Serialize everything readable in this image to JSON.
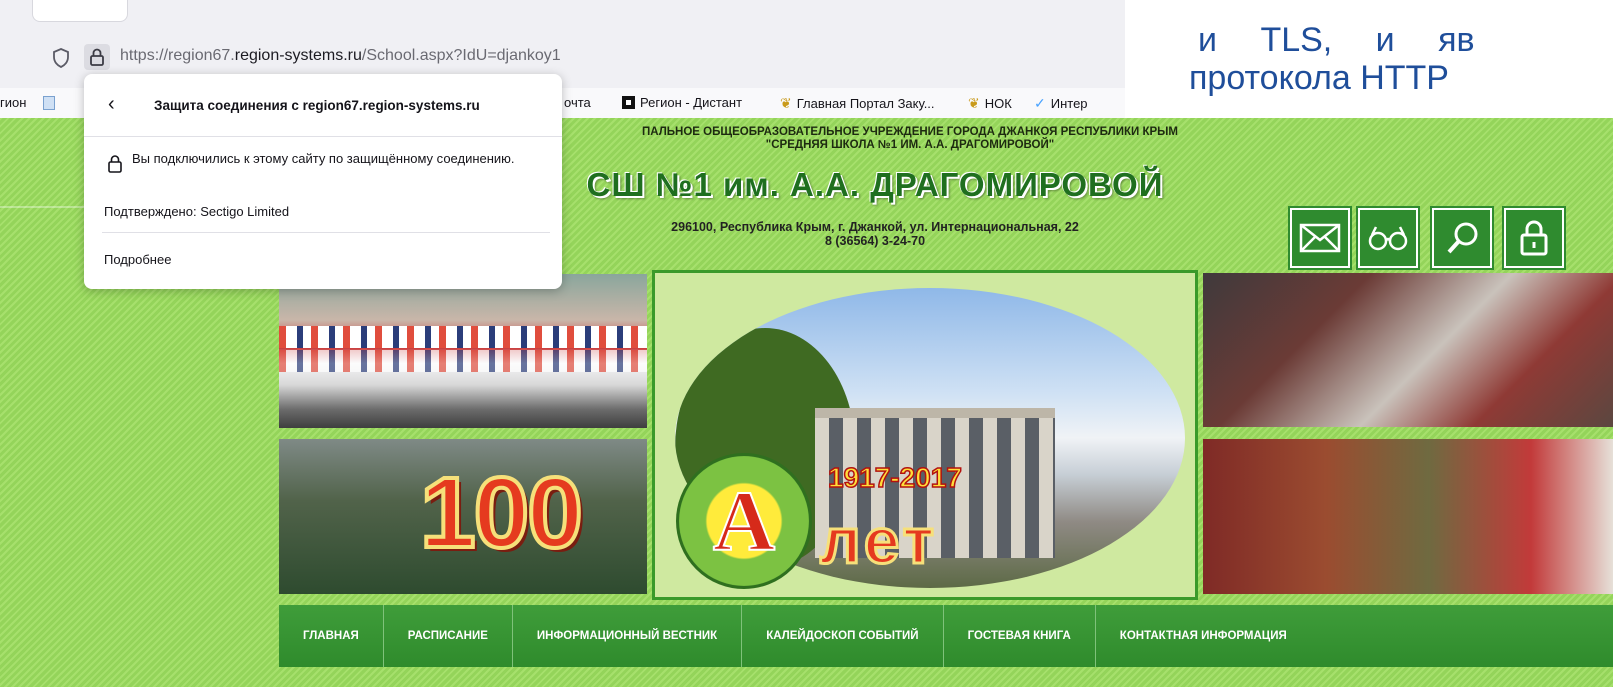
{
  "browser": {
    "url_prefix": "https://region67.",
    "url_domain": "region-systems.ru",
    "url_path": "/School.aspx?IdU=djankoy1"
  },
  "bookmarks": {
    "left_cut": "гион",
    "items": [
      {
        "label": "очта"
      },
      {
        "label": "Регион - Дистант"
      },
      {
        "label": "Главная Портал Заку..."
      },
      {
        "label": "НОК"
      },
      {
        "label": "Интер"
      }
    ]
  },
  "slide": {
    "line1": "и TLS, и яв",
    "line2": "протокола HTTP"
  },
  "popup": {
    "title": "Защита соединения с region67.region-systems.ru",
    "message": "Вы подключились к этому сайту по защищённому соединению.",
    "verified": "Подтверждено: Sectigo Limited",
    "more": "Подробнее"
  },
  "site": {
    "org_line1": "ПАЛЬНОЕ ОБЩЕОБРАЗОВАТЕЛЬНОЕ УЧРЕЖДЕНИЕ ГОРОДА ДЖАНКОЯ РЕСПУБЛИКИ КРЫМ",
    "org_line2": "\"СРЕДНЯЯ ШКОЛА №1 ИМ. А.А. ДРАГОМИРОВОЙ\"",
    "school_name": "СШ №1 им. А.А. ДРАГОМИРОВОЙ",
    "address": "296100, Республика Крым, г. Джанкой, ул. Интернациональная, 22",
    "phone": "8 (36564) 3-24-70",
    "banner_hundred": "100",
    "banner_letter": "А",
    "banner_years": "1917-2017",
    "banner_let": "лет",
    "nav": [
      "ГЛАВНАЯ",
      "РАСПИСАНИЕ",
      "ИНФОРМАЦИОННЫЙ ВЕСТНИК",
      "КАЛЕЙДОСКОП СОБЫТИЙ",
      "ГОСТЕВАЯ КНИГА",
      "КОНТАКТНАЯ ИНФОРМАЦИЯ"
    ]
  },
  "colors": {
    "site_green": "#94d45a",
    "nav_green": "#2f8b2c",
    "title_green": "#1f6f1f",
    "slide_blue": "#1f4e9a"
  }
}
